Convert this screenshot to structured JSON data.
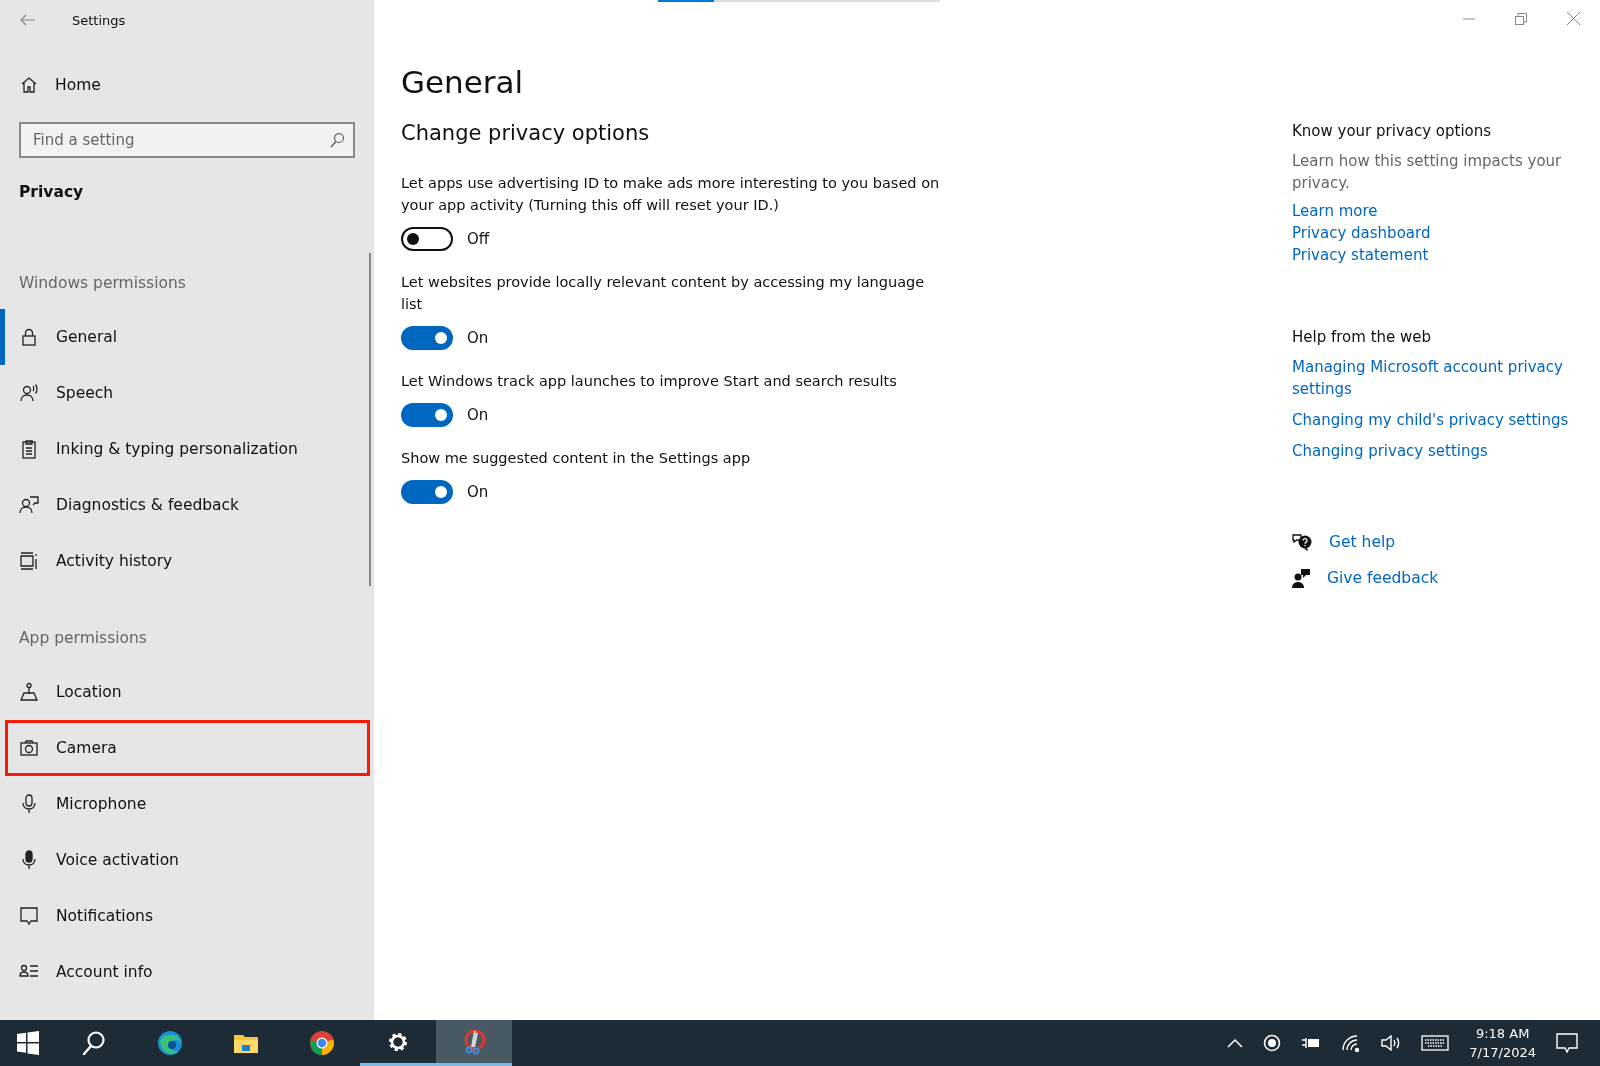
{
  "window": {
    "title": "Settings"
  },
  "progress": {
    "level": 0.2
  },
  "sidebar": {
    "home": "Home",
    "search": {
      "placeholder": "Find a setting"
    },
    "section": "Privacy",
    "groups": [
      {
        "heading": "Windows permissions",
        "items": [
          {
            "label": "General",
            "kind": "lock",
            "selected": true,
            "highlighted": false
          },
          {
            "label": "Speech",
            "kind": "speech",
            "selected": false,
            "highlighted": false
          },
          {
            "label": "Inking & typing personalization",
            "kind": "clipboard",
            "selected": false,
            "highlighted": false
          },
          {
            "label": "Diagnostics & feedback",
            "kind": "diagnostics",
            "selected": false,
            "highlighted": false
          },
          {
            "label": "Activity history",
            "kind": "activity",
            "selected": false,
            "highlighted": false
          }
        ]
      },
      {
        "heading": "App permissions",
        "items": [
          {
            "label": "Location",
            "kind": "location",
            "selected": false,
            "highlighted": false
          },
          {
            "label": "Camera",
            "kind": "camera",
            "selected": false,
            "highlighted": true
          },
          {
            "label": "Microphone",
            "kind": "microphone",
            "selected": false,
            "highlighted": false
          },
          {
            "label": "Voice activation",
            "kind": "voice",
            "selected": false,
            "highlighted": false
          },
          {
            "label": "Notifications",
            "kind": "notifications",
            "selected": false,
            "highlighted": false
          },
          {
            "label": "Account info",
            "kind": "account",
            "selected": false,
            "highlighted": false
          }
        ]
      }
    ]
  },
  "main": {
    "title": "General",
    "subtitle": "Change privacy options",
    "settings": [
      {
        "text": "Let apps use advertising ID to make ads more interesting to you based on your app activity (Turning this off will reset your ID.)",
        "on": false,
        "state": "Off"
      },
      {
        "text": "Let websites provide locally relevant content by accessing my language list",
        "on": true,
        "state": "On"
      },
      {
        "text": "Let Windows track app launches to improve Start and search results",
        "on": true,
        "state": "On"
      },
      {
        "text": "Show me suggested content in the Settings app",
        "on": true,
        "state": "On"
      }
    ]
  },
  "aside": {
    "sections": [
      {
        "heading": "Know your privacy options",
        "text": "Learn how this setting impacts your privacy.",
        "links": [
          "Learn more",
          "Privacy dashboard",
          "Privacy statement"
        ]
      },
      {
        "heading": "Help from the web",
        "links": [
          "Managing Microsoft account privacy settings",
          "Changing my child's privacy settings",
          "Changing privacy settings"
        ]
      }
    ],
    "actions": [
      {
        "kind": "help",
        "label": "Get help"
      },
      {
        "kind": "feedback",
        "label": "Give feedback"
      }
    ]
  },
  "taskbar": {
    "apps": [
      {
        "kind": "start",
        "open": false,
        "active": false
      },
      {
        "kind": "search",
        "open": false,
        "active": false
      },
      {
        "kind": "edge",
        "open": false,
        "active": false
      },
      {
        "kind": "folder",
        "open": false,
        "active": false
      },
      {
        "kind": "chrome",
        "open": false,
        "active": false
      },
      {
        "kind": "settings",
        "open": true,
        "active": false
      },
      {
        "kind": "snip",
        "open": true,
        "active": true
      }
    ],
    "time": "9:18 AM",
    "date": "7/17/2024"
  }
}
